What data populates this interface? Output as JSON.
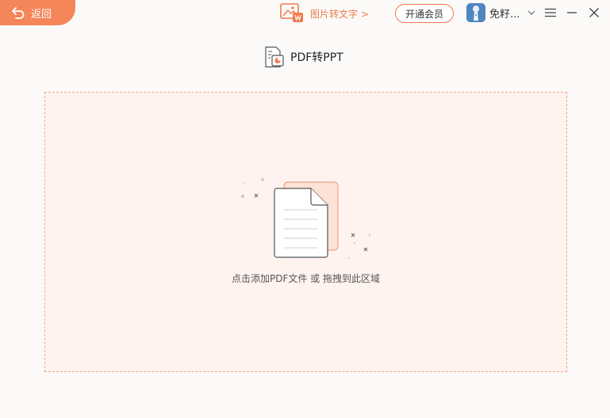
{
  "header": {
    "back_label": "返回",
    "promo_label": "图片转文字 >",
    "vip_label": "开通会员",
    "user_name": "免籽..."
  },
  "main": {
    "title": "PDF转PPT",
    "drop_hint": "点击添加PDF文件 或 拖拽到此区域"
  },
  "icons": {
    "back": "back-arrow-icon",
    "promo": "image-to-text-icon",
    "user_menu": "chevron-down-icon",
    "menu": "hamburger-menu-icon",
    "minimize": "minimize-icon",
    "close": "close-icon",
    "title": "pdf-to-ppt-icon",
    "upload": "document-upload-icon"
  },
  "colors": {
    "accent": "#f4865a",
    "accent_text": "#f07a4c",
    "drop_background": "#fff3f0",
    "drop_border": "#f4a382"
  }
}
